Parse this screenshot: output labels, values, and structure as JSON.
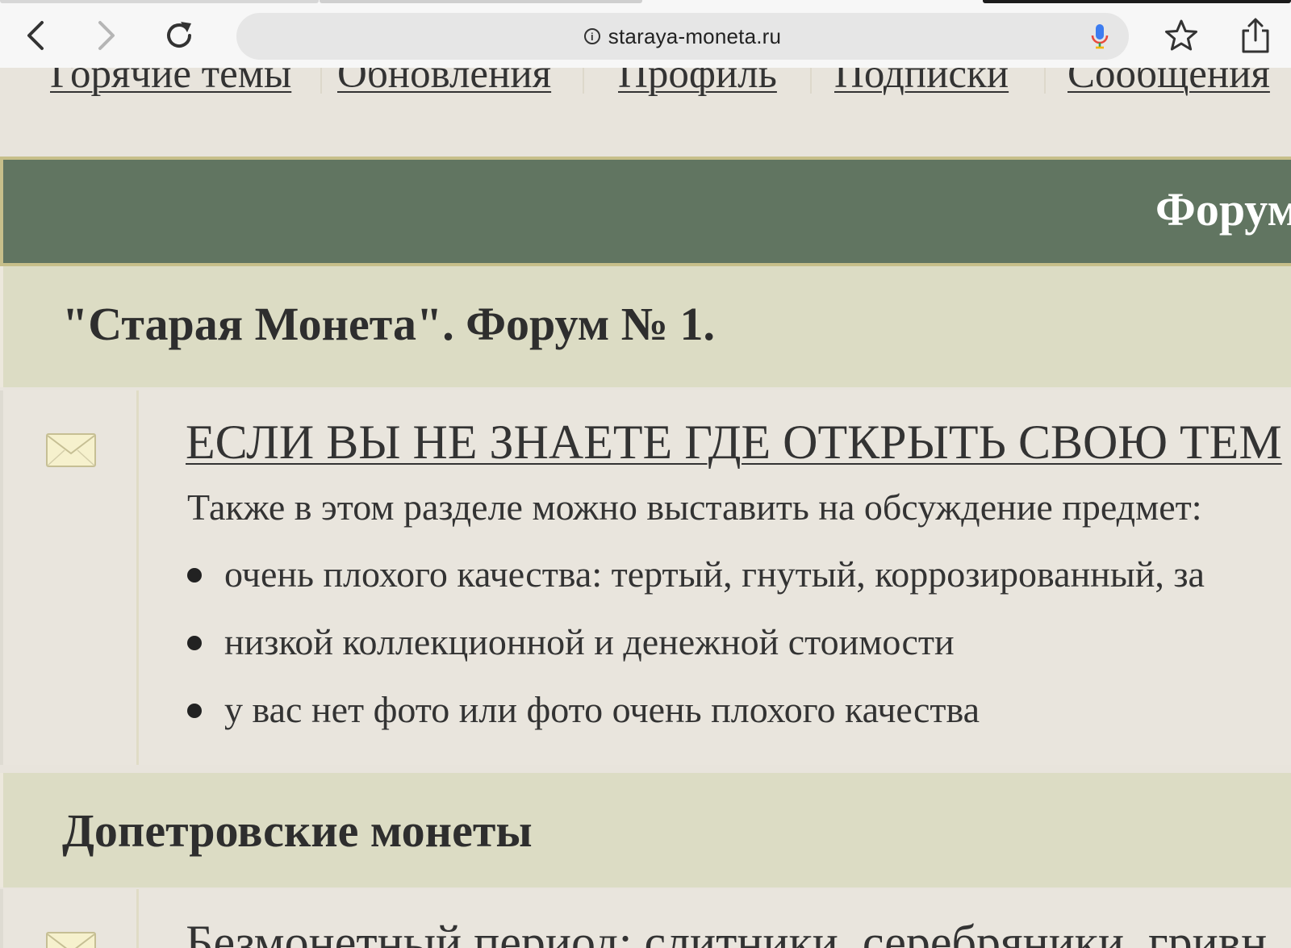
{
  "browser": {
    "url": "staraya-moneta.ru",
    "icons": {
      "back": "chevron-left-icon",
      "forward": "chevron-right-icon",
      "reload": "reload-icon",
      "info": "info-icon",
      "mic": "microphone-icon",
      "bookmark": "star-icon",
      "share": "share-icon"
    },
    "info_glyph": "i"
  },
  "nav": {
    "items": [
      "Горячие темы",
      "Обновления",
      "Профиль",
      "Подписки",
      "Сообщения"
    ]
  },
  "banner": {
    "title": "Форум"
  },
  "sections": [
    {
      "title": "\"Старая Монета\". Форум № 1.",
      "forums": [
        {
          "title": "ЕСЛИ ВЫ НЕ ЗНАЕТЕ ГДЕ ОТКРЫТЬ СВОЮ ТЕМ",
          "description": "Также в этом разделе можно выставить на обсуждение предмет:",
          "bullets": [
            "очень плохого качества: тертый, гнутый, коррозированный, за",
            "низкой коллекционной и денежной стоимости",
            "у вас нет фото или фото очень плохого качества"
          ]
        }
      ]
    },
    {
      "title": "Допетровские монеты",
      "forums": [
        {
          "title": "Безмонетный период: слитники, серебряники, гривн"
        }
      ]
    }
  ],
  "colors": {
    "page_bg": "#e8e4dc",
    "banner_bg": "#617561",
    "banner_border": "#c7bf8a",
    "section_bg": "#dcdcc4",
    "text": "#333333",
    "mic_blue": "#3d7cf0",
    "mic_red": "#e84a3c"
  }
}
